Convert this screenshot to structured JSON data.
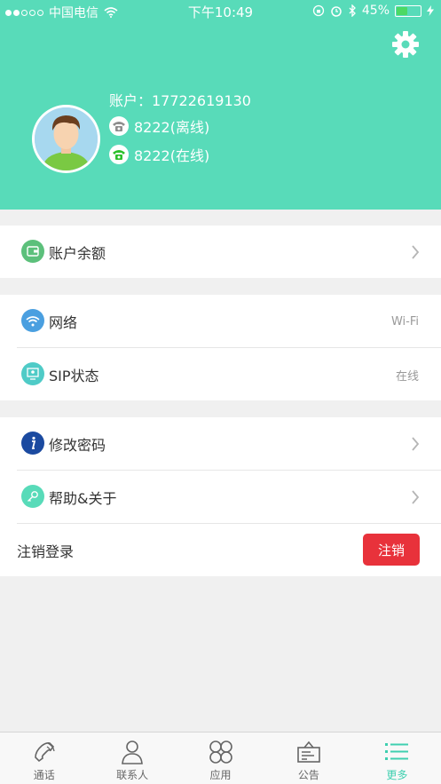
{
  "status_bar": {
    "carrier": "中国电信",
    "time": "下午10:49",
    "battery_percent": "45%",
    "battery_level": 0.45
  },
  "profile": {
    "account_label": "账户：17722619130",
    "lines": [
      {
        "text": "8222(离线)",
        "state": "offline",
        "color": "#8e8e8e"
      },
      {
        "text": "8222(在线)",
        "state": "online",
        "color": "#2bc02b"
      }
    ]
  },
  "menu": {
    "balance": {
      "label": "账户余额",
      "icon": "wallet-icon",
      "color": "#5cc07b"
    },
    "network": {
      "label": "网络",
      "value": "Wi-Fi",
      "icon": "wifi-icon",
      "color": "#4a9fe0"
    },
    "sip": {
      "label": "SIP状态",
      "value": "在线",
      "icon": "monitor-icon",
      "color": "#4fcbc7"
    },
    "password": {
      "label": "修改密码",
      "icon": "info-icon",
      "color": "#1b4aa0"
    },
    "help": {
      "label": "帮助&关于",
      "icon": "key-icon",
      "color": "#58dbb9"
    },
    "logout": {
      "label": "注销登录",
      "button": "注销"
    }
  },
  "tabs": [
    {
      "label": "通话",
      "icon": "phone-icon",
      "active": false
    },
    {
      "label": "联系人",
      "icon": "person-icon",
      "active": false
    },
    {
      "label": "应用",
      "icon": "apps-icon",
      "active": false
    },
    {
      "label": "公告",
      "icon": "notice-icon",
      "active": false
    },
    {
      "label": "更多",
      "icon": "more-list-icon",
      "active": true
    }
  ],
  "colors": {
    "header": "#58dbb9",
    "accent": "#3fcfb0",
    "logout": "#e8323b"
  }
}
